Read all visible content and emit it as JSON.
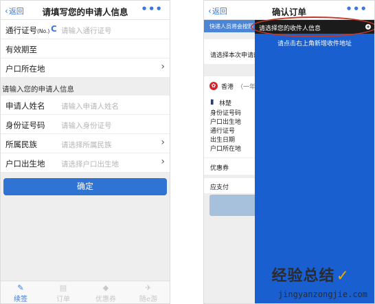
{
  "left": {
    "nav": {
      "back": "返回",
      "title": "请填写您的申请人信息",
      "more": "•••"
    },
    "rows1": [
      {
        "label": "通行证号",
        "label_small": "(No.)",
        "icon": "C",
        "placeholder": "请输入通行证号",
        "arrow": false
      },
      {
        "label": "有效期至",
        "placeholder": "",
        "arrow": false
      },
      {
        "label": "户口所在地",
        "placeholder": "",
        "arrow": true
      }
    ],
    "section_title": "请输入您的申请人信息",
    "rows2": [
      {
        "label": "申请人姓名",
        "placeholder": "请输入申请人姓名",
        "arrow": false
      },
      {
        "label": "身份证号码",
        "placeholder": "请输入身份证号",
        "arrow": false
      },
      {
        "label": "所属民族",
        "placeholder": "请选择所属民族",
        "arrow": true
      },
      {
        "label": "户口出生地",
        "placeholder": "请选择户口出生地",
        "arrow": true
      }
    ],
    "confirm_label": "确定",
    "tabs": [
      {
        "label": "续签",
        "icon": "edit-icon",
        "active": true
      },
      {
        "label": "订单",
        "icon": "document-icon",
        "active": false
      },
      {
        "label": "优惠券",
        "icon": "tag-icon",
        "active": false
      },
      {
        "label": "随e游",
        "icon": "plane-icon",
        "active": false
      }
    ]
  },
  "right": {
    "nav": {
      "back": "返回",
      "title": "确认订单",
      "more": "•••"
    },
    "notice": "快递人员将会按照",
    "choose_text": "请选择本次申请的",
    "hk_label": "香港",
    "hk_extra": "（一年",
    "applicant_name": "林楚",
    "fields": [
      "身份证号码",
      "户口出生地",
      "通行证号",
      "出生日期",
      "户口所在地"
    ],
    "coupon_label": "优惠券",
    "pay_label": "应支付",
    "overlay": {
      "header": "请选择您的收件人信息",
      "hint": "请点击右上角新增收件地址"
    },
    "watermark_main": "经验总结",
    "watermark_url": "jingyanzongjie.com"
  }
}
